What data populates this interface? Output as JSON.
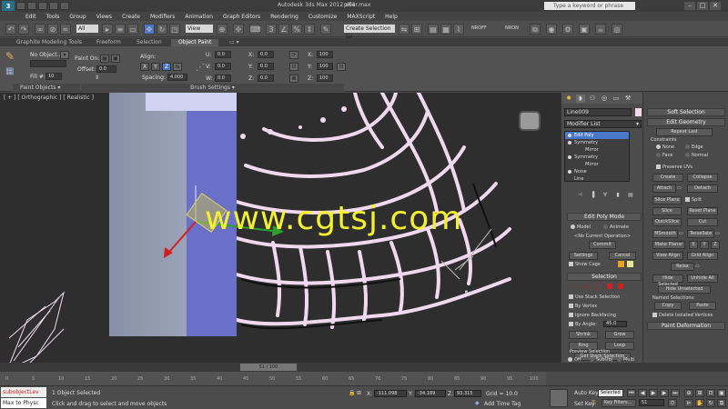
{
  "titlebar": {
    "app_name": "Autodesk 3ds Max  2012 x64",
    "file_name": "pillar.max",
    "search_placeholder": "Type a keyword or phrase",
    "logo": "3"
  },
  "menu": [
    "Edit",
    "Tools",
    "Group",
    "Views",
    "Create",
    "Modifiers",
    "Animation",
    "Graph Editors",
    "Rendering",
    "Customize",
    "MAXScript",
    "Help"
  ],
  "toolbar": {
    "filter_label": "All",
    "view_label": "View",
    "selection_set_placeholder": "Create Selection Se",
    "nroff_label": "NROFF",
    "nron_label": "NRON"
  },
  "ribbon": {
    "tabs": [
      "Graphite Modeling Tools",
      "Freeform",
      "Selection",
      "Object Paint"
    ],
    "active_tab": "Object Paint",
    "paint_object": "No Object...",
    "fill_label": "Fill #:",
    "fill_value": "10",
    "paint_on_label": "Paint On:",
    "offset_label": "Offset:",
    "offset_value": "0.0",
    "align_label": "Align:",
    "axes": [
      "X",
      "Y",
      "Z"
    ],
    "spacing_label": "Spacing:",
    "spacing_value": "4.000",
    "u_label": "U:",
    "v_label": "V:",
    "w_label": "W:",
    "uvw_value": "0.0",
    "x_label": "X:",
    "y_label": "Y:",
    "z_label": "Z:",
    "xyz_value": "0.0",
    "scale_x_label": "X:",
    "scale_y_label": "Y:",
    "scale_z_label": "Z:",
    "scale_value": "100",
    "footer_paint_objects": "Paint Objects",
    "footer_brush_settings": "Brush Settings"
  },
  "viewport": {
    "label": "[ + ] [ Orthographic ] [ Realistic ]",
    "watermark": "www.cgtsj.com"
  },
  "command_panel": {
    "object_name": "Line009",
    "modifier_list": "Modifier List",
    "stack": [
      {
        "label": "Edit Poly",
        "selected": true,
        "sub": false
      },
      {
        "label": "Symmetry",
        "selected": false,
        "sub": false
      },
      {
        "label": "Mirror",
        "selected": false,
        "sub": true
      },
      {
        "label": "Symmetry",
        "selected": false,
        "sub": false
      },
      {
        "label": "Mirror",
        "selected": false,
        "sub": true
      },
      {
        "label": "Noise",
        "selected": false,
        "sub": false
      },
      {
        "label": "Line",
        "selected": false,
        "sub": false
      }
    ],
    "edit_poly_mode": "Edit Poly Mode",
    "model_label": "Model",
    "animate_label": "Animate",
    "no_current_op": "<No Current Operation>",
    "commit": "Commit",
    "settings": "Settings",
    "cancel": "Cancel",
    "show_cage": "Show Cage",
    "selection": "Selection",
    "use_stack_selection": "Use Stack Selection",
    "by_vertex": "By Vertex",
    "ignore_backfacing": "Ignore Backfacing",
    "by_angle": "By Angle:",
    "by_angle_value": "45.0",
    "shrink": "Shrink",
    "grow": "Grow",
    "ring": "Ring",
    "loop": "Loop",
    "get_stack_selection": "Get Stack Selection",
    "preview_selection": "Preview Selection",
    "off": "Off",
    "subobj": "SubObj",
    "multi": "Multi"
  },
  "graphite_panel": {
    "soft_selection": "Soft Selection",
    "edit_geometry": "Edit Geometry",
    "repeat_last": "Repeat Last",
    "constraints": "Constraints",
    "none": "None",
    "edge": "Edge",
    "face": "Face",
    "normal": "Normal",
    "preserve_uvs": "Preserve UVs",
    "create": "Create",
    "collapse": "Collapse",
    "attach": "Attach",
    "detach": "Detach",
    "slice_plane": "Slice Plane",
    "split": "Split",
    "slice": "Slice",
    "reset_plane": "Reset Plane",
    "quickslice": "QuickSlice",
    "cut": "Cut",
    "msmooth": "MSmooth",
    "tessellate": "Tessellate",
    "make_planar": "Make Planar",
    "x": "X",
    "y": "Y",
    "z": "Z",
    "view_align": "View Align",
    "grid_align": "Grid Align",
    "relax": "Relax",
    "hide_selected": "Hide Selected",
    "unhide_all": "Unhide All",
    "hide_unselected": "Hide Unselected",
    "named_selections": "Named Selections:",
    "copy": "Copy",
    "paste": "Paste",
    "delete_isolated": "Delete Isolated Vertices",
    "paint_deformation": "Paint Deformation"
  },
  "timeline": {
    "frame": "51 / 100",
    "ticks": [
      "0",
      "5",
      "10",
      "15",
      "20",
      "25",
      "30",
      "35",
      "40",
      "45",
      "50",
      "55",
      "60",
      "65",
      "70",
      "75",
      "80",
      "85",
      "90",
      "95",
      "100"
    ]
  },
  "status": {
    "maxscript_line1": "subobjectLev",
    "maxscript_line2": "Max to Physc",
    "selected": "1 Object Selected",
    "prompt": "Click and drag to select and move objects",
    "x_label": "X:",
    "x_value": "-111.098",
    "y_label": "Y:",
    "y_value": "-34.189",
    "z_label": "Z:",
    "z_value": "93.315",
    "grid": "Grid = 10.0",
    "add_time_tag": "Add Time Tag",
    "auto_key": "Auto Key",
    "auto_key_value": "Selected",
    "set_key": "Set Key",
    "key_filters": "Key Filters...",
    "frame_value": "51"
  }
}
